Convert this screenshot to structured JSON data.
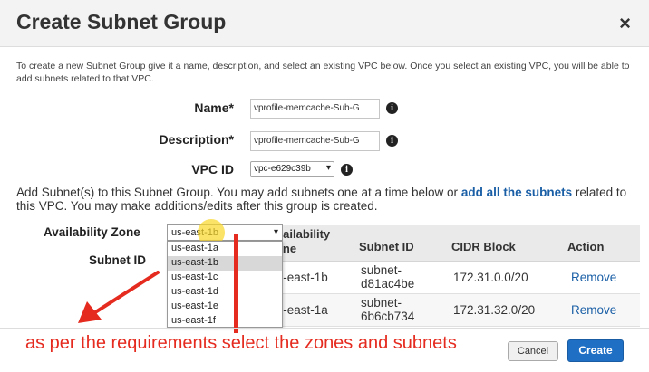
{
  "dialog": {
    "title": "Create Subnet Group",
    "close_glyph": "×",
    "intro": "To create a new Subnet Group give it a name, description, and select an existing VPC below. Once you select an existing VPC, you will be able to add subnets related to that VPC."
  },
  "form": {
    "name_label": "Name*",
    "name_value": "vprofile-memcache-Sub-G",
    "description_label": "Description*",
    "description_value": "vprofile-memcache-Sub-G",
    "vpc_label": "VPC ID",
    "vpc_value": "vpc-e629c39b",
    "info_glyph": "i"
  },
  "add_subnets": {
    "text_before": "Add Subnet(s) to this Subnet Group. You may add subnets one at a time below or ",
    "link": "add all the subnets",
    "text_after": " related to this VPC. You may make additions/edits after this group is created."
  },
  "availability_zone": {
    "label": "Availability Zone",
    "selected": "us-east-1b",
    "options": [
      "us-east-1a",
      "us-east-1b",
      "us-east-1c",
      "us-east-1d",
      "us-east-1e",
      "us-east-1f"
    ],
    "selected_index": 1
  },
  "subnet_id_label": "Subnet ID",
  "table": {
    "headers": {
      "availability": "Availability",
      "zone": "Zone",
      "subnet_id": "Subnet ID",
      "cidr": "CIDR Block",
      "action": "Action"
    },
    "rows": [
      {
        "az": "us-east-1b",
        "subnet_line1": "subnet-",
        "subnet_line2": "d81ac4be",
        "cidr": "172.31.0.0/20",
        "action": "Remove"
      },
      {
        "az": "us-east-1a",
        "subnet_line1": "subnet-",
        "subnet_line2": "6b6cb734",
        "cidr": "172.31.32.0/20",
        "action": "Remove"
      }
    ]
  },
  "annotation": "as per the requirements select the zones and subnets",
  "buttons": {
    "cancel": "Cancel",
    "create": "Create"
  },
  "colors": {
    "annotation": "#e52b1f",
    "link": "#1a5fa6",
    "primary": "#1f6fc5"
  }
}
